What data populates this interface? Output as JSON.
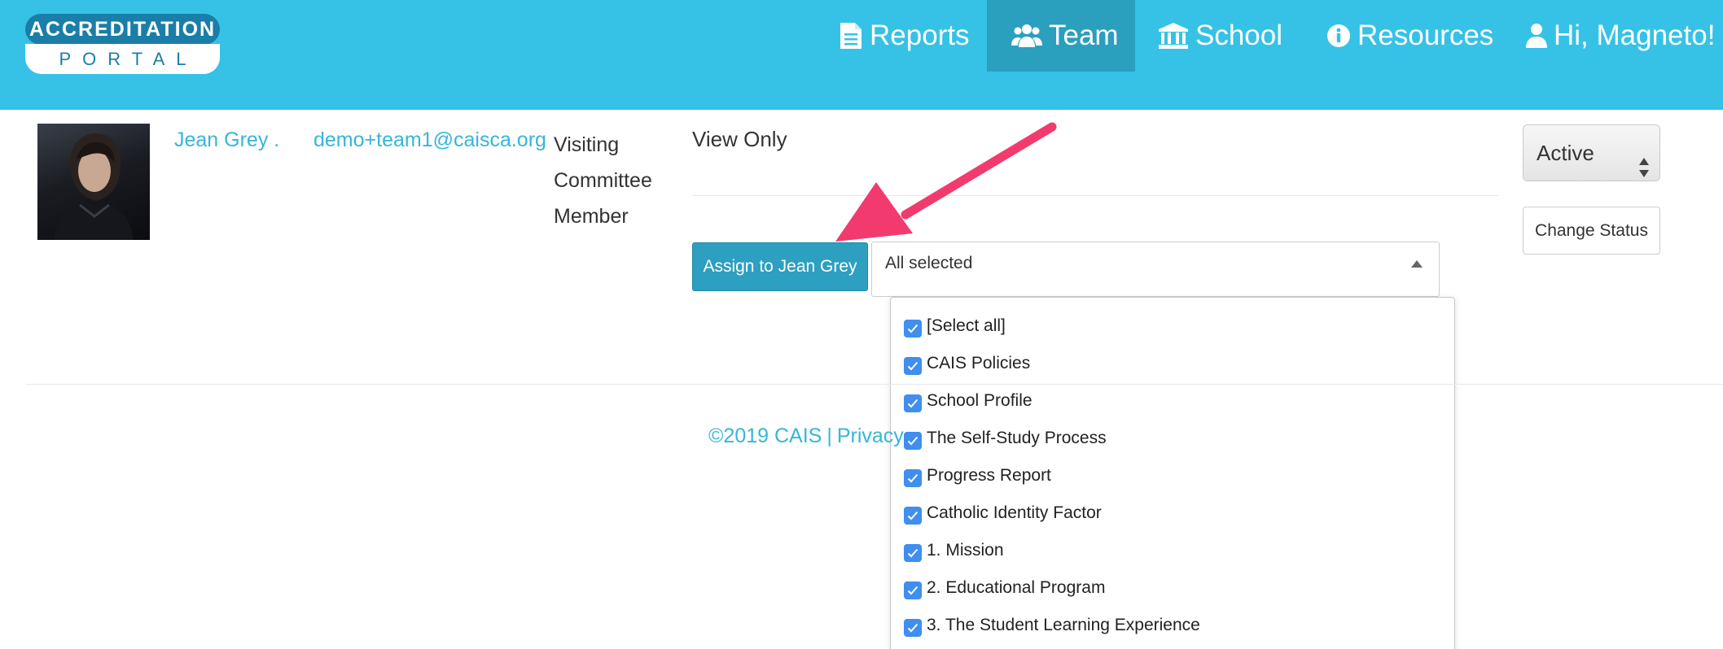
{
  "logo": {
    "line1": "ACCREDITATION",
    "line2": "PORTAL"
  },
  "nav": {
    "reports": "Reports",
    "team": "Team",
    "school": "School",
    "resources": "Resources",
    "user": "Hi, Magneto!"
  },
  "member": {
    "name": "Jean Grey .",
    "email": "demo+team1@caisca.org",
    "role": "Visiting Committee Member",
    "access": "View Only"
  },
  "assign": {
    "button_label": "Assign to Jean Grey",
    "selected_text": "All selected",
    "options": [
      "[Select all]",
      "CAIS Policies",
      "School Profile",
      "The Self-Study Process",
      "Progress Report",
      "Catholic Identity Factor",
      "1. Mission",
      "2. Educational Program",
      "3. The Student Learning Experience"
    ]
  },
  "status": {
    "value": "Active",
    "change_label": "Change Status"
  },
  "footer": {
    "copyright": "©2019 CAIS",
    "privacy": "Privacy"
  },
  "colors": {
    "header": "#35c2e6",
    "team_active": "#2a9fbe",
    "link": "#35b6d8",
    "annotation_arrow": "#f23a6e",
    "checkbox": "#3f8ef0"
  }
}
